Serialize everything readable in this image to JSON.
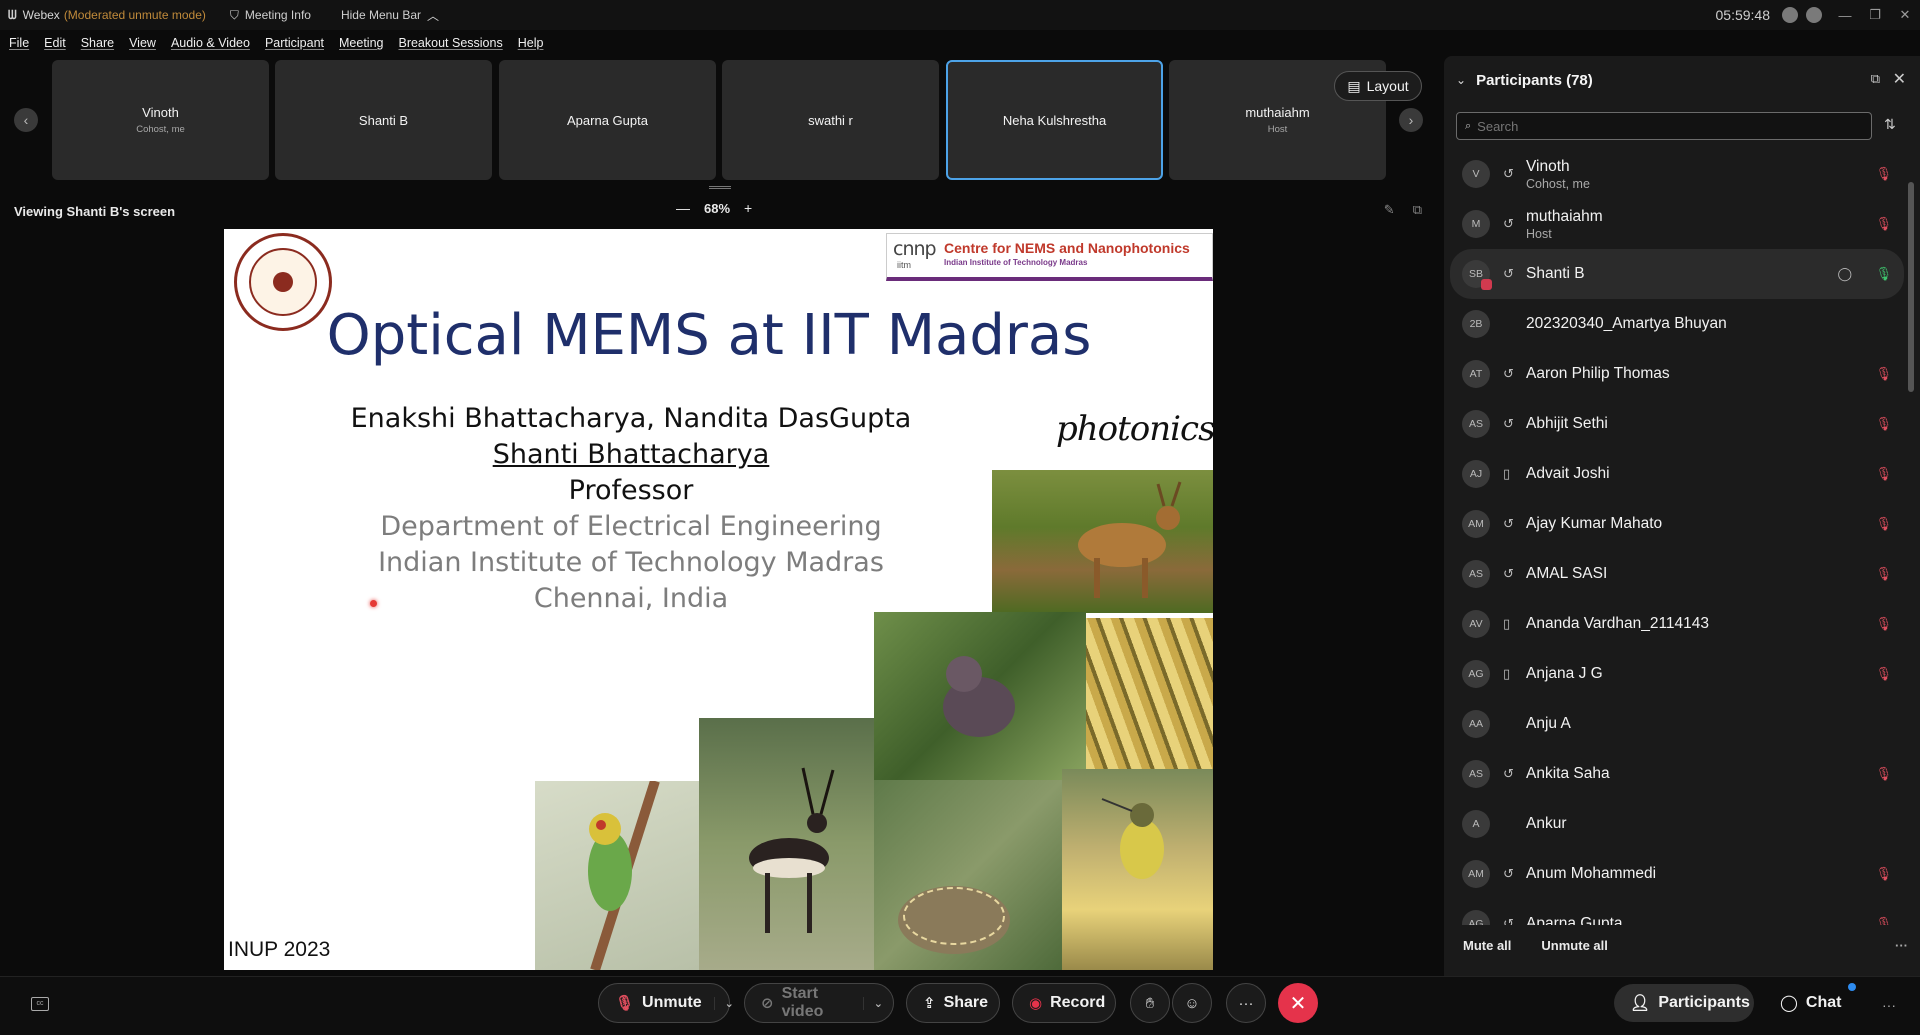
{
  "titlebar": {
    "app_name": "Webex",
    "mode": "(Moderated unmute mode)",
    "meeting_info": "Meeting Info",
    "hide_menu": "Hide Menu Bar",
    "time": "05:59:48"
  },
  "menu": [
    "File",
    "Edit",
    "Share",
    "View",
    "Audio & Video",
    "Participant",
    "Meeting",
    "Breakout Sessions",
    "Help"
  ],
  "strip": {
    "tiles": [
      {
        "name": "Vinoth",
        "role": "Cohost, me"
      },
      {
        "name": "Shanti B",
        "role": ""
      },
      {
        "name": "Aparna Gupta",
        "role": ""
      },
      {
        "name": "swathi r",
        "role": ""
      },
      {
        "name": "Neha Kulshrestha",
        "role": ""
      },
      {
        "name": "muthaiahm",
        "role": "Host"
      }
    ],
    "active_tile": "Neha Kulshrestha",
    "layout_label": "Layout"
  },
  "viewing": {
    "label": "Viewing Shanti B's screen",
    "zoom": "68%"
  },
  "slide": {
    "cnnp_logo": "cnnp",
    "cnnp_sub": "iitm",
    "cnnp_title": "Centre for NEMS and Nanophotonics",
    "cnnp_inst": "Indian Institute of Technology Madras",
    "title": "Optical MEMS at IIT Madras",
    "authors": "Enakshi Bhattacharya, Nandita DasGupta",
    "speaker": "Shanti Bhattacharya",
    "role": "Professor",
    "department": "Department of Electrical Engineering",
    "institute": "Indian Institute of Technology Madras",
    "city": "Chennai, India",
    "photonics": "photonics",
    "footer": "INUP 2023"
  },
  "participants": {
    "title": "Participants (78)",
    "search_placeholder": "Search",
    "list": [
      {
        "initials": "V",
        "name": "Vinoth",
        "role": "Cohost, me",
        "device": "headset",
        "mic": "muted"
      },
      {
        "initials": "M",
        "name": "muthaiahm",
        "role": "Host",
        "device": "headset",
        "mic": "muted"
      },
      {
        "initials": "SB",
        "name": "Shanti B",
        "role": "",
        "device": "headset",
        "mic": "on",
        "selected": true
      },
      {
        "initials": "2B",
        "name": "202320340_Amartya Bhuyan",
        "role": "",
        "device": "",
        "mic": ""
      },
      {
        "initials": "AT",
        "name": "Aaron Philip Thomas",
        "role": "",
        "device": "headset",
        "mic": "muted"
      },
      {
        "initials": "AS",
        "name": "Abhijit Sethi",
        "role": "",
        "device": "headset",
        "mic": "muted"
      },
      {
        "initials": "AJ",
        "name": "Advait Joshi",
        "role": "",
        "device": "phone",
        "mic": "muted"
      },
      {
        "initials": "AM",
        "name": "Ajay Kumar Mahato",
        "role": "",
        "device": "headset",
        "mic": "muted"
      },
      {
        "initials": "AS",
        "name": "AMAL SASI",
        "role": "",
        "device": "headset",
        "mic": "muted"
      },
      {
        "initials": "AV",
        "name": "Ananda Vardhan_2114143",
        "role": "",
        "device": "phone",
        "mic": "muted"
      },
      {
        "initials": "AG",
        "name": "Anjana J G",
        "role": "",
        "device": "phone",
        "mic": "muted"
      },
      {
        "initials": "AA",
        "name": "Anju A",
        "role": "",
        "device": "",
        "mic": ""
      },
      {
        "initials": "AS",
        "name": "Ankita Saha",
        "role": "",
        "device": "headset",
        "mic": "muted"
      },
      {
        "initials": "A",
        "name": "Ankur",
        "role": "",
        "device": "",
        "mic": ""
      },
      {
        "initials": "AM",
        "name": "Anum Mohammedi",
        "role": "",
        "device": "headset",
        "mic": "muted"
      },
      {
        "initials": "AG",
        "name": "Aparna Gupta",
        "role": "",
        "device": "headset",
        "mic": "muted"
      }
    ],
    "mute_all": "Mute all",
    "unmute_all": "Unmute all"
  },
  "controls": {
    "unmute": "Unmute",
    "start_video": "Start video",
    "share": "Share",
    "record": "Record",
    "participants": "Participants",
    "chat": "Chat"
  },
  "colors": {
    "accent": "#4da3e8",
    "leave": "#e5334b",
    "muted": "#e04e5e",
    "mic_on": "#3ec46d",
    "slide_title": "#1f2f6b"
  }
}
